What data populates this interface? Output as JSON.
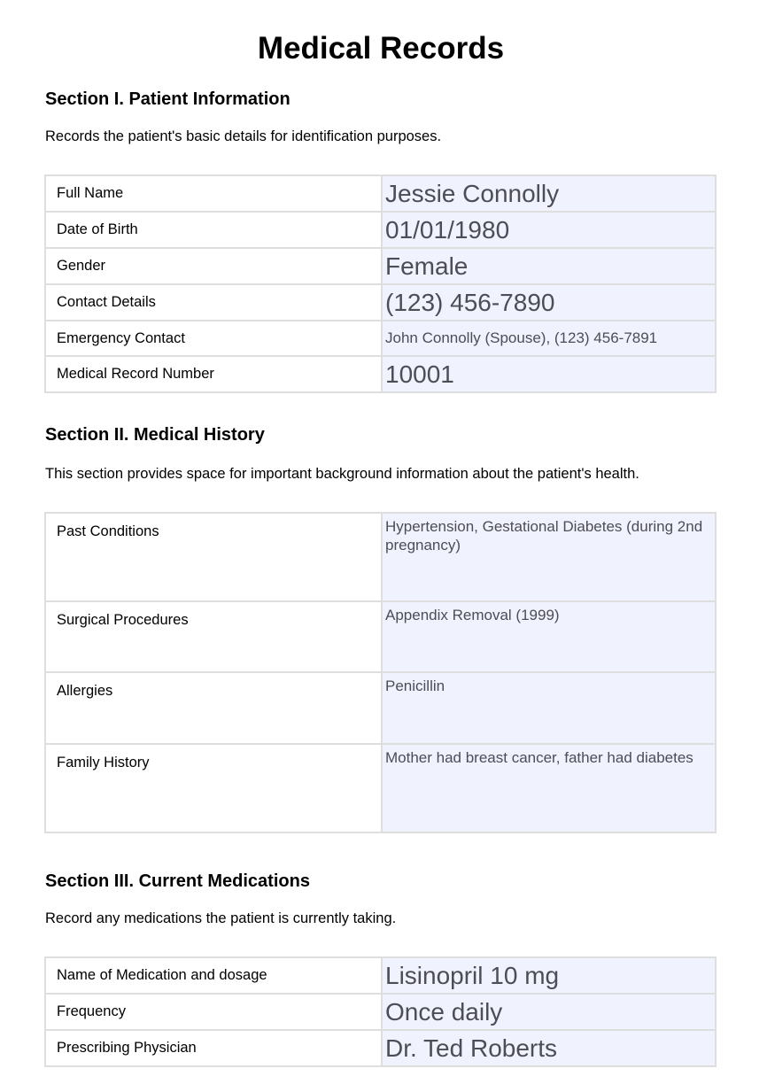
{
  "title": "Medical Records",
  "section1": {
    "heading": "Section I. Patient Information",
    "description": "Records the patient's basic details for identification purposes.",
    "rows": [
      {
        "label": "Full Name",
        "value": "Jessie Connolly"
      },
      {
        "label": "Date of Birth",
        "value": "01/01/1980"
      },
      {
        "label": "Gender",
        "value": "Female"
      },
      {
        "label": "Contact Details",
        "value": "(123) 456-7890"
      },
      {
        "label": "Emergency Contact",
        "value": "John Connolly (Spouse), (123) 456-7891"
      },
      {
        "label": "Medical Record Number",
        "value": "10001"
      }
    ]
  },
  "section2": {
    "heading": "Section II. Medical History",
    "description": "This section provides space for important background information about the patient's health.",
    "rows": [
      {
        "label": "Past Conditions",
        "value": "Hypertension, Gestational Diabetes (during 2nd pregnancy)"
      },
      {
        "label": "Surgical Procedures",
        "value": "Appendix Removal (1999)"
      },
      {
        "label": "Allergies",
        "value": "Penicillin"
      },
      {
        "label": "Family History",
        "value": "Mother had breast cancer, father had diabetes"
      }
    ]
  },
  "section3": {
    "heading": "Section III. Current Medications",
    "description": "Record any medications the patient is currently taking.",
    "rows": [
      {
        "label": "Name of Medication and dosage",
        "value": "Lisinopril 10 mg"
      },
      {
        "label": "Frequency",
        "value": "Once daily"
      },
      {
        "label": "Prescribing Physician",
        "value": "Dr. Ted Roberts"
      }
    ]
  }
}
